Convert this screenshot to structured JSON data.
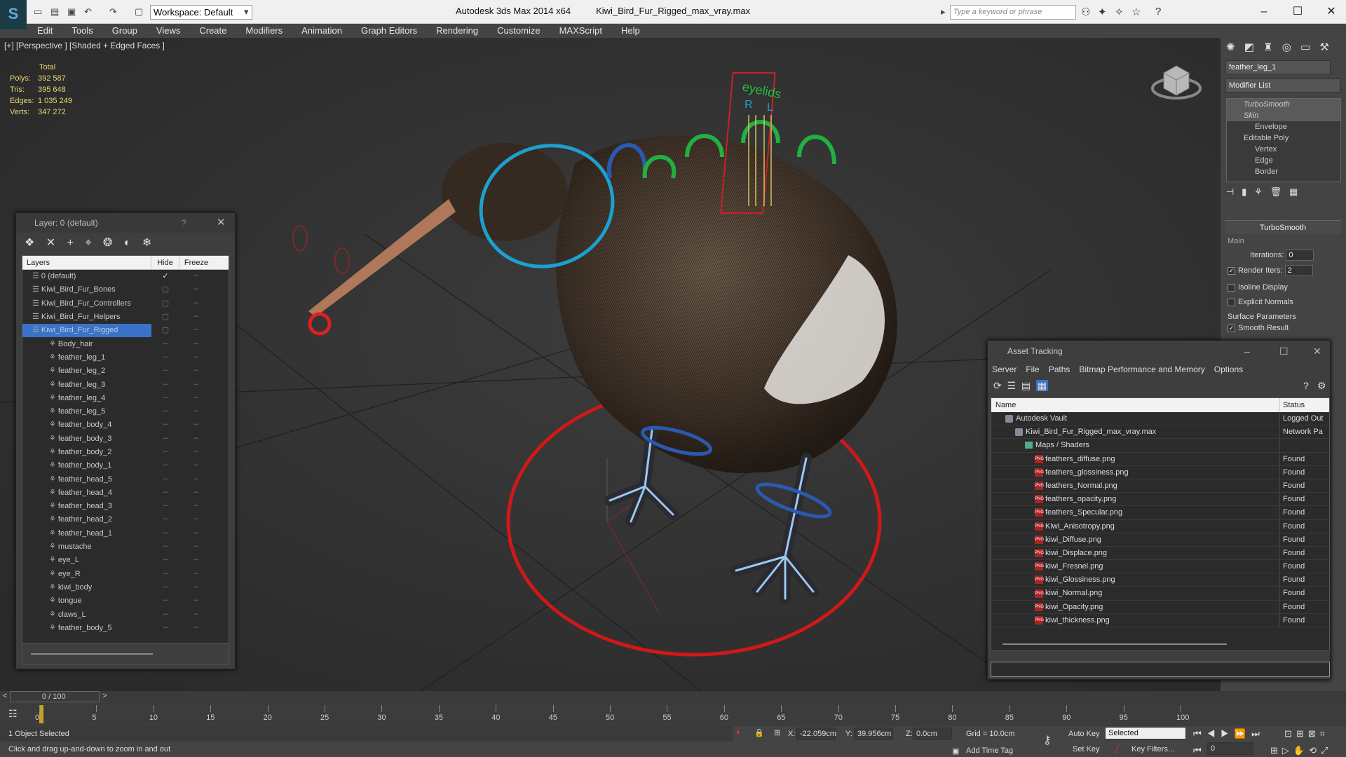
{
  "app": {
    "title": "Autodesk 3ds Max  2014 x64",
    "file": "Kiwi_Bird_Fur_Rigged_max_vray.max",
    "workspace": "Workspace: Default",
    "search_placeholder": "Type a keyword or phrase"
  },
  "menu": [
    "Edit",
    "Tools",
    "Group",
    "Views",
    "Create",
    "Modifiers",
    "Animation",
    "Graph Editors",
    "Rendering",
    "Customize",
    "MAXScript",
    "Help"
  ],
  "viewport": {
    "label": "[+] [Perspective ] [Shaded + Edged Faces ]",
    "stats": {
      "header": "Total",
      "rows": [
        {
          "k": "Polys:",
          "v": "392 587"
        },
        {
          "k": "Tris:",
          "v": "395 648"
        },
        {
          "k": "Edges:",
          "v": "1 035 249"
        },
        {
          "k": "Verts:",
          "v": "347 272"
        }
      ]
    },
    "annotations": {
      "eyelids": "eyelids",
      "r": "R",
      "l": "L"
    }
  },
  "layer_panel": {
    "title": "Layer: 0 (default)",
    "help": "?",
    "col_layers": "Layers",
    "col_hide": "Hide",
    "col_freeze": "Freeze",
    "rows": [
      {
        "name": "0 (default)",
        "indent": 0,
        "check": "✓"
      },
      {
        "name": "Kiwi_Bird_Fur_Bones",
        "indent": 0
      },
      {
        "name": "Kiwi_Bird_Fur_Controllers",
        "indent": 0
      },
      {
        "name": "Kiwi_Bird_Fur_Helpers",
        "indent": 0
      },
      {
        "name": "Kiwi_Bird_Fur_Rigged",
        "indent": 0,
        "selected": true
      },
      {
        "name": "Body_hair",
        "indent": 1
      },
      {
        "name": "feather_leg_1",
        "indent": 1
      },
      {
        "name": "feather_leg_2",
        "indent": 1
      },
      {
        "name": "feather_leg_3",
        "indent": 1
      },
      {
        "name": "feather_leg_4",
        "indent": 1
      },
      {
        "name": "feather_leg_5",
        "indent": 1
      },
      {
        "name": "feather_body_4",
        "indent": 1
      },
      {
        "name": "feather_body_3",
        "indent": 1
      },
      {
        "name": "feather_body_2",
        "indent": 1
      },
      {
        "name": "feather_body_1",
        "indent": 1
      },
      {
        "name": "feather_head_5",
        "indent": 1
      },
      {
        "name": "feather_head_4",
        "indent": 1
      },
      {
        "name": "feather_head_3",
        "indent": 1
      },
      {
        "name": "feather_head_2",
        "indent": 1
      },
      {
        "name": "feather_head_1",
        "indent": 1
      },
      {
        "name": "mustache",
        "indent": 1
      },
      {
        "name": "eye_L",
        "indent": 1
      },
      {
        "name": "eye_R",
        "indent": 1
      },
      {
        "name": "kiwi_body",
        "indent": 1
      },
      {
        "name": "tongue",
        "indent": 1
      },
      {
        "name": "claws_L",
        "indent": 1
      },
      {
        "name": "feather_body_5",
        "indent": 1
      }
    ]
  },
  "command_panel": {
    "object_name": "feather_leg_1",
    "modifier_list": "Modifier List",
    "stack": [
      {
        "label": "TurboSmooth",
        "italic": true
      },
      {
        "label": "Skin",
        "italic": true
      },
      {
        "label": "Envelope",
        "sub": true
      },
      {
        "label": "Editable Poly"
      },
      {
        "label": "Vertex",
        "sub": true
      },
      {
        "label": "Edge",
        "sub": true
      },
      {
        "label": "Border",
        "sub": true
      }
    ],
    "rollout": "TurboSmooth",
    "main": "Main",
    "iterations_label": "Iterations:",
    "iterations": "0",
    "render_iters_label": "Render Iters:",
    "render_iters": "2",
    "isoline": "Isoline Display",
    "explicit": "Explicit Normals",
    "surface": "Surface Parameters",
    "smooth": "Smooth Result"
  },
  "asset_tracking": {
    "title": "Asset Tracking",
    "menu": [
      "Server",
      "File",
      "Paths",
      "Bitmap Performance and Memory",
      "Options"
    ],
    "col_name": "Name",
    "col_status": "Status",
    "rows": [
      {
        "name": "Autodesk Vault",
        "status": "Logged Out",
        "icon": "vault",
        "indent": 1
      },
      {
        "name": "Kiwi_Bird_Fur_Rigged_max_vray.max",
        "status": "Network Pa",
        "icon": "max",
        "indent": 2
      },
      {
        "name": "Maps / Shaders",
        "status": "",
        "icon": "folder",
        "indent": 3
      },
      {
        "name": "feathers_diffuse.png",
        "status": "Found",
        "icon": "png",
        "indent": 4
      },
      {
        "name": "feathers_glossiness.png",
        "status": "Found",
        "icon": "png",
        "indent": 4
      },
      {
        "name": "feathers_Normal.png",
        "status": "Found",
        "icon": "png",
        "indent": 4
      },
      {
        "name": "feathers_opacity.png",
        "status": "Found",
        "icon": "png",
        "indent": 4
      },
      {
        "name": "feathers_Specular.png",
        "status": "Found",
        "icon": "png",
        "indent": 4
      },
      {
        "name": "Kiwi_Anisotropy.png",
        "status": "Found",
        "icon": "png",
        "indent": 4
      },
      {
        "name": "kiwi_Diffuse.png",
        "status": "Found",
        "icon": "png",
        "indent": 4
      },
      {
        "name": "kiwi_Displace.png",
        "status": "Found",
        "icon": "png",
        "indent": 4
      },
      {
        "name": "kiwi_Fresnel.png",
        "status": "Found",
        "icon": "png",
        "indent": 4
      },
      {
        "name": "kiwi_Glossiness.png",
        "status": "Found",
        "icon": "png",
        "indent": 4
      },
      {
        "name": "kiwi_Normal.png",
        "status": "Found",
        "icon": "png",
        "indent": 4
      },
      {
        "name": "kiwi_Opacity.png",
        "status": "Found",
        "icon": "png",
        "indent": 4
      },
      {
        "name": "kiwi_thickness.png",
        "status": "Found",
        "icon": "png",
        "indent": 4
      }
    ]
  },
  "timeline": {
    "frame": "0 / 100",
    "ticks": [
      "0",
      "5",
      "10",
      "15",
      "20",
      "25",
      "30",
      "35",
      "40",
      "45",
      "50",
      "55",
      "60",
      "65",
      "70",
      "75",
      "80",
      "85",
      "90",
      "95",
      "100"
    ]
  },
  "statusbar": {
    "selected": "1 Object Selected",
    "hint": "Click and drag up-and-down to zoom in and out",
    "x_label": "X:",
    "x": "-22.059cm",
    "y_label": "Y:",
    "y": "39.956cm",
    "z_label": "Z:",
    "z": "0.0cm",
    "grid": "Grid = 10.0cm",
    "add_time_tag": "Add Time Tag",
    "auto_key": "Auto Key",
    "set_key": "Set Key",
    "selected_mode": "Selected",
    "key_filters": "Key Filters...",
    "current_frame": "0"
  }
}
